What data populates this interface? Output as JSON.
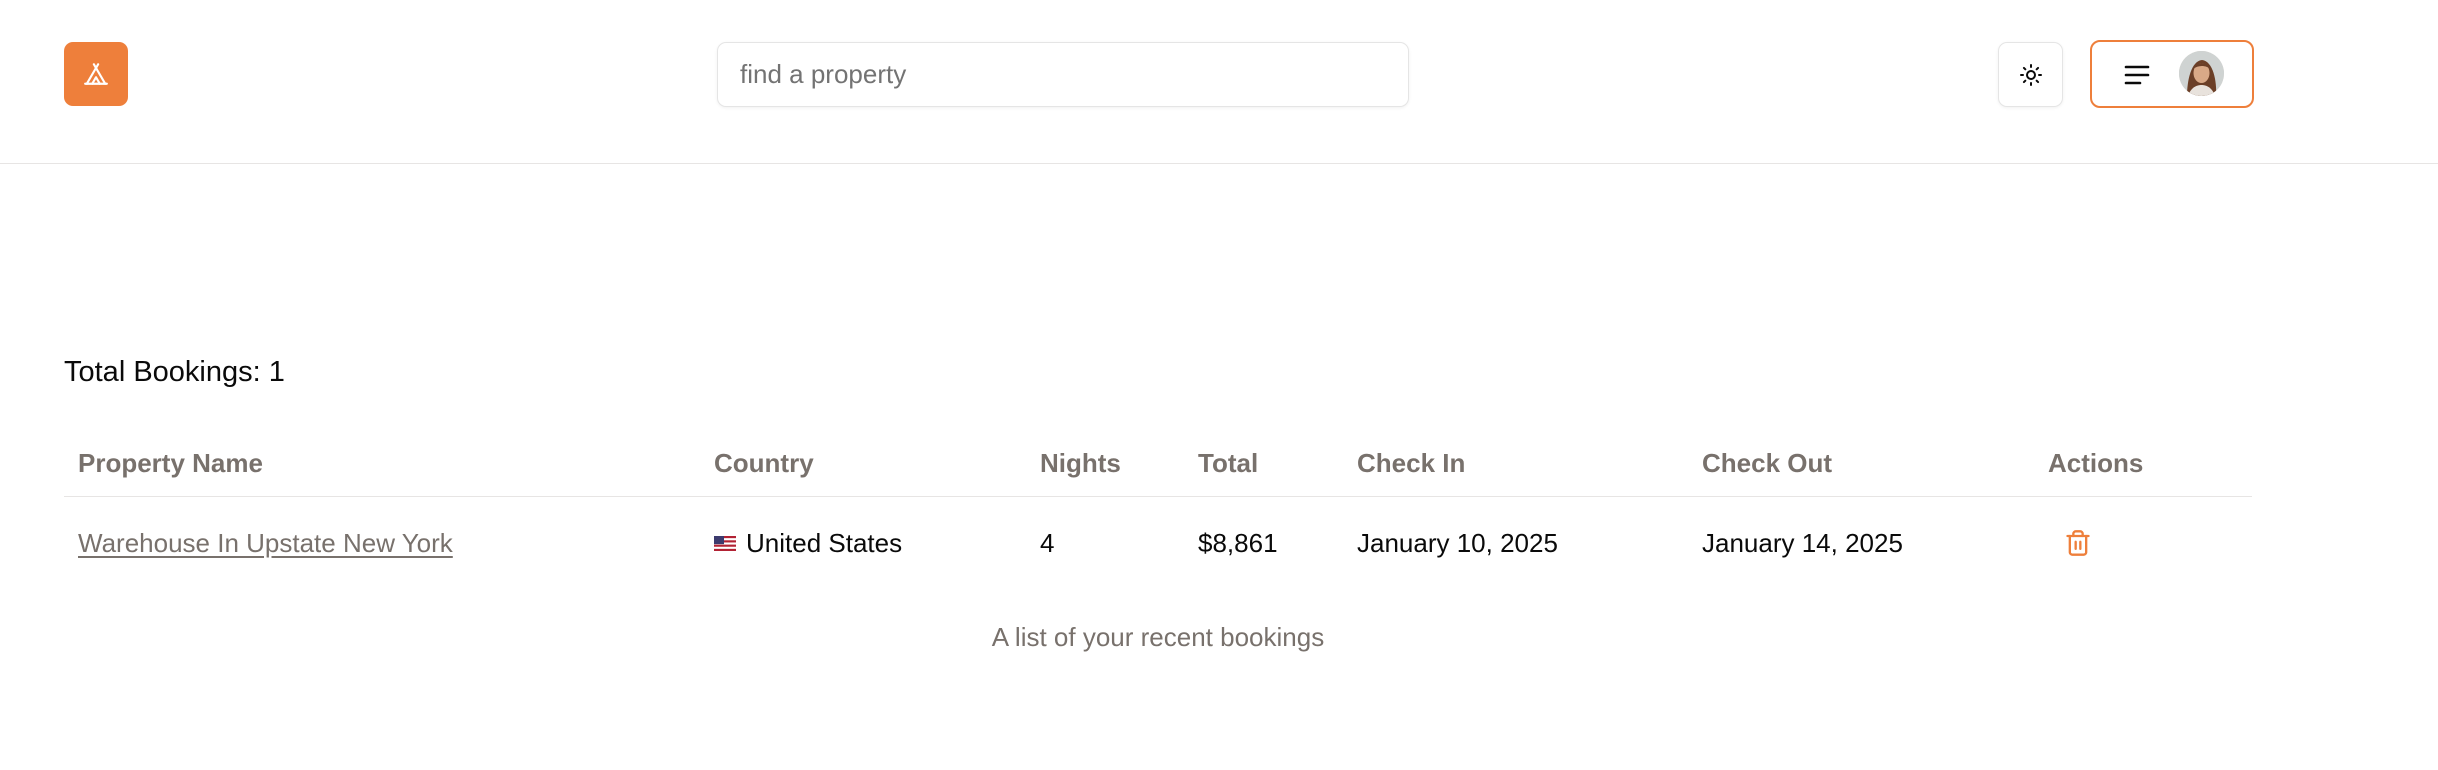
{
  "app": {
    "brand_color": "#ee7f3b",
    "logo_icon": "tent-icon"
  },
  "header": {
    "search": {
      "placeholder": "find a property",
      "value": ""
    },
    "theme_toggle_icon": "sun-icon",
    "menu_icon": "menu-icon"
  },
  "summary": {
    "total_label": "Total Bookings: 1"
  },
  "table": {
    "headers": [
      "Property Name",
      "Country",
      "Nights",
      "Total",
      "Check In",
      "Check Out",
      "Actions"
    ],
    "rows": [
      {
        "property": "Warehouse In Upstate New York",
        "country": "United States",
        "country_flag": "us-flag-icon",
        "nights": "4",
        "total": "$8,861",
        "check_in": "January 10, 2025",
        "check_out": "January 14, 2025",
        "action_icon": "trash-icon"
      }
    ],
    "caption": "A list of your recent bookings"
  }
}
